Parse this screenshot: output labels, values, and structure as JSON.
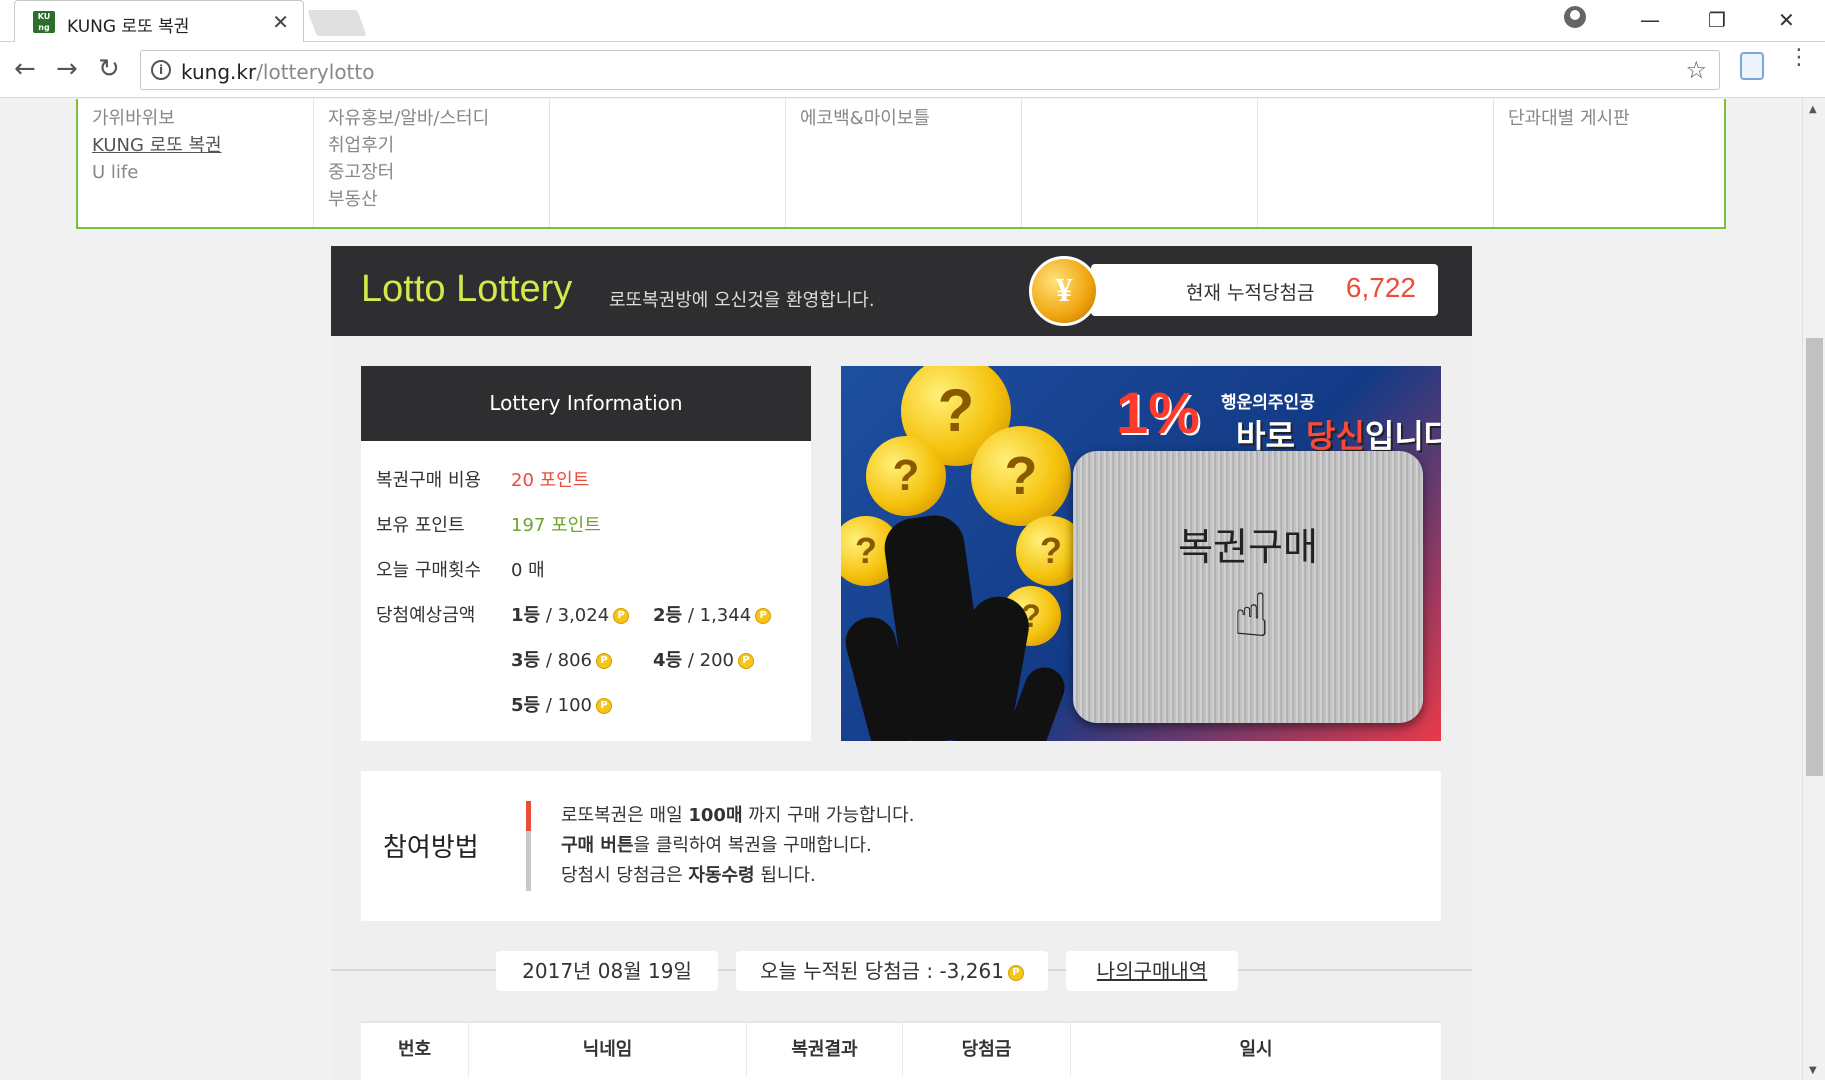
{
  "browser": {
    "tab_title": "KUNG 로또 복권",
    "favicon_text": "KU ng",
    "url_domain": "kung.kr",
    "url_path": "/lotterylotto"
  },
  "menu": {
    "col1": [
      "가위바위보",
      "KUNG 로또 복권",
      "U life"
    ],
    "col2": [
      "자유홍보/알바/스터디",
      "취업후기",
      "중고장터",
      "부동산"
    ],
    "col4": [
      "에코백&마이보틀"
    ],
    "col7": [
      "단과대별 게시판"
    ]
  },
  "lotto": {
    "title": "Lotto Lottery",
    "welcome": "로또복권방에 오신것을 환영합니다.",
    "coin_symbol": "¥",
    "jackpot_label": "현재 누적당첨금",
    "jackpot_value": "6,722"
  },
  "info": {
    "title": "Lottery Information",
    "cost_label": "복권구매 비용",
    "cost_value": "20 포인트",
    "points_label": "보유 포인트",
    "points_value": "197 포인트",
    "today_label": "오늘 구매횟수",
    "today_value": "0 매",
    "prize_label": "당첨예상금액",
    "prizes": [
      {
        "rank": "1등",
        "amount": "/ 3,024"
      },
      {
        "rank": "2등",
        "amount": "/ 1,344"
      },
      {
        "rank": "3등",
        "amount": "/ 806"
      },
      {
        "rank": "4등",
        "amount": "/ 200"
      },
      {
        "rank": "5등",
        "amount": "/ 100"
      }
    ],
    "point_coin": "P"
  },
  "banner": {
    "percent": "1%",
    "tagline_small": "행운의주인공",
    "tagline_big_1": "바로 ",
    "tagline_big_hl": "당신",
    "tagline_big_2": "입니다!",
    "button_label": "복권구매",
    "coin_mark": "?"
  },
  "how": {
    "title": "참여방법",
    "line1_pre": "로또복권은 매일 ",
    "line1_bold": "100매",
    "line1_post": " 까지 구매 가능합니다.",
    "line2_bold": "구매 버튼",
    "line2_post": "을 클릭하여 복권을 구매합니다.",
    "line3_pre": "당첨시 당첨금은 ",
    "line3_bold": "자동수령",
    "line3_post": " 됩니다."
  },
  "summary": {
    "date": "2017년 08월 19일",
    "today_total": "오늘 누적된 당첨금 : -3,261",
    "my_history": "나의구매내역"
  },
  "table": {
    "headers": [
      "번호",
      "닉네임",
      "복권결과",
      "당첨금",
      "일시"
    ]
  }
}
